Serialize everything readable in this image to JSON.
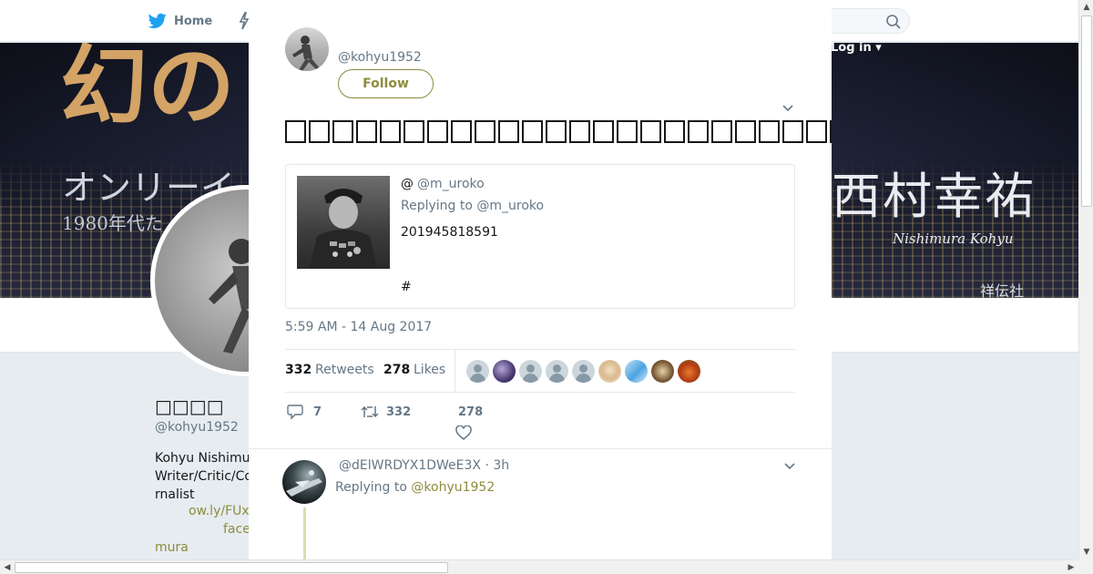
{
  "topbar": {
    "home_label": "Home",
    "login_label": "Log in"
  },
  "banner": {
    "title_partial": "幻の",
    "subtitle_partial": "オンリーイ",
    "era_partial": "1980年代た",
    "name_jp": "西村幸祐",
    "name_roman": "Nishimura Kohyu",
    "publisher": "祥伝社"
  },
  "background_profile": {
    "display_name": "□□□□",
    "handle": "@kohyu1952",
    "bio": "Kohyu Nishimu\nWriter/Critic/Co\nrnalist",
    "link_1": "ow.ly/FUx",
    "link_2": "face",
    "link_3": "mura"
  },
  "tweet": {
    "author_handle": "@kohyu1952",
    "follow_label": "Follow",
    "text_tail": "→□□→□□□□",
    "quote": {
      "at": "@",
      "handle": "@m_uroko",
      "replying_to": "Replying to @m_uroko",
      "body": "201945818591",
      "hashtag": "#"
    },
    "timestamp": "5:59 AM - 14 Aug 2017",
    "retweets": {
      "count": "332",
      "label": "Retweets"
    },
    "likes": {
      "count": "278",
      "label": "Likes"
    },
    "reply_count": "7",
    "retweet_count": "332",
    "like_count": "278"
  },
  "reply": {
    "handle_time": "@dElWRDYX1DWeE3X · 3h",
    "replying_prefix": "Replying to",
    "replying_handle": "@kohyu1952"
  },
  "colors": {
    "link": "#8c8c3c",
    "muted": "#657786",
    "text": "#14171a",
    "divider": "#e1e8ed"
  }
}
